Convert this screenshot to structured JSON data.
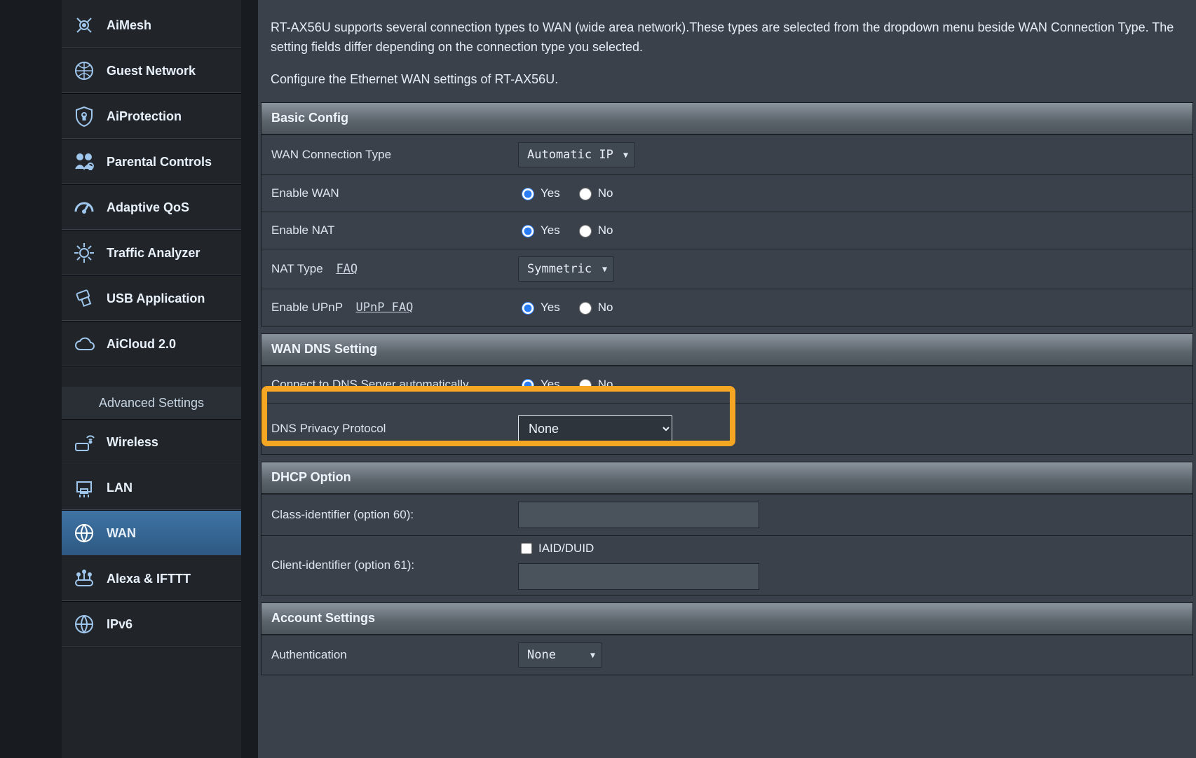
{
  "sidebar": {
    "groupA": [
      {
        "icon": "aimesh",
        "label": "AiMesh"
      },
      {
        "icon": "guest",
        "label": "Guest Network"
      },
      {
        "icon": "shield",
        "label": "AiProtection"
      },
      {
        "icon": "parental",
        "label": "Parental Controls"
      },
      {
        "icon": "qos",
        "label": "Adaptive QoS"
      },
      {
        "icon": "traffic",
        "label": "Traffic Analyzer"
      },
      {
        "icon": "usb",
        "label": "USB Application"
      },
      {
        "icon": "cloud",
        "label": "AiCloud 2.0"
      }
    ],
    "advanced_header": "Advanced Settings",
    "groupB": [
      {
        "icon": "wireless",
        "label": "Wireless"
      },
      {
        "icon": "lan",
        "label": "LAN"
      },
      {
        "icon": "wan",
        "label": "WAN",
        "active": true
      },
      {
        "icon": "alexa",
        "label": "Alexa & IFTTT"
      },
      {
        "icon": "ipv6",
        "label": "IPv6"
      }
    ]
  },
  "intro": {
    "p1": "RT-AX56U supports several connection types to WAN (wide area network).These types are selected from the dropdown menu beside WAN Connection Type. The setting fields differ depending on the connection type you selected.",
    "p2": "Configure the Ethernet WAN settings of RT-AX56U."
  },
  "panels": {
    "basic": {
      "title": "Basic Config",
      "wan_type_label": "WAN Connection Type",
      "wan_type_value": "Automatic IP",
      "enable_wan_label": "Enable WAN",
      "enable_nat_label": "Enable NAT",
      "nat_type_label": "NAT Type",
      "nat_type_faq": "FAQ",
      "nat_type_value": "Symmetric",
      "upnp_label": "Enable UPnP",
      "upnp_faq": "UPnP FAQ",
      "yes": "Yes",
      "no": "No"
    },
    "dns": {
      "title": "WAN DNS Setting",
      "auto_label": "Connect to DNS Server automatically",
      "privacy_label": "DNS Privacy Protocol",
      "privacy_value": "None",
      "yes": "Yes",
      "no": "No"
    },
    "dhcp": {
      "title": "DHCP Option",
      "class_label": "Class-identifier (option 60):",
      "client_label": "Client-identifier (option 61):",
      "iaid_label": "IAID/DUID"
    },
    "account": {
      "title": "Account Settings",
      "auth_label": "Authentication",
      "auth_value": "None"
    }
  }
}
